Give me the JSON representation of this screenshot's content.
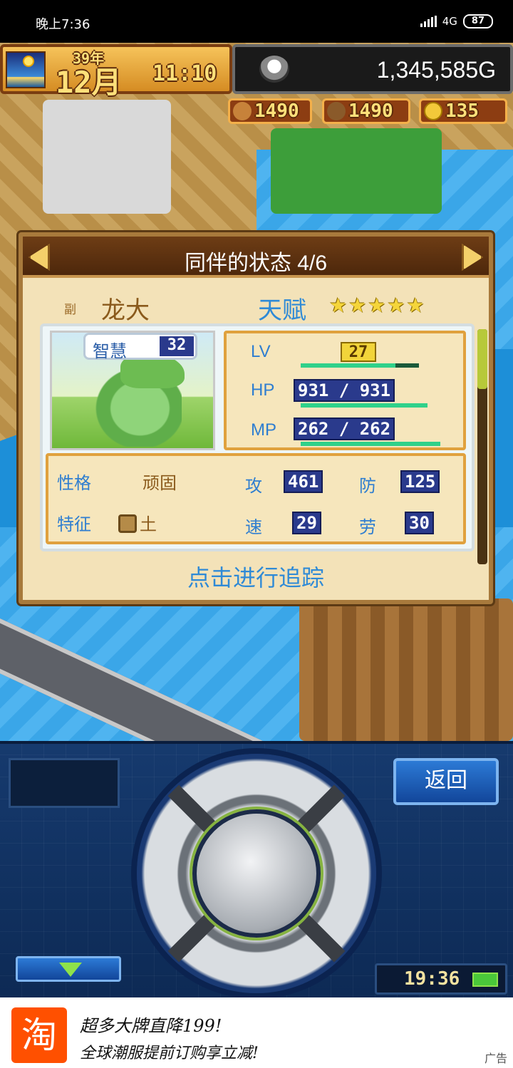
{
  "status_bar": {
    "time": "晚上7:36",
    "network": "4G",
    "battery": "87"
  },
  "hud": {
    "year": "39年",
    "month": "12月",
    "clock": "11:10",
    "money": "1,345,585G",
    "resources": [
      {
        "name": "wood-plank",
        "value": "1490"
      },
      {
        "name": "timber",
        "value": "1490"
      },
      {
        "name": "coin",
        "value": "135"
      }
    ]
  },
  "dialog": {
    "title": "同伴的状态 4/6",
    "sub_tag": "副",
    "name": "龙大",
    "talent_label": "天赋",
    "stars": "★★★★★",
    "star_count": 5,
    "wisdom_label": "智慧",
    "wisdom_value": "32",
    "lv_label": "LV",
    "lv_value": "27",
    "lv_progress": 0.8,
    "hp_label": "HP",
    "hp_value": "931 / 931",
    "mp_label": "MP",
    "mp_value": "262 / 262",
    "personality_label": "性格",
    "personality_value": "顽固",
    "trait_label": "特征",
    "trait_value": "土",
    "atk_label": "攻",
    "atk_value": "461",
    "def_label": "防",
    "def_value": "125",
    "spd_label": "速",
    "spd_value": "29",
    "lab_label": "劳",
    "lab_value": "30",
    "track_label": "点击进行追踪"
  },
  "controller": {
    "back_label": "返回",
    "clock": "19:36"
  },
  "ad": {
    "logo": "淘",
    "line1": "超多大牌直降199!",
    "line2": "全球潮服提前订购享立减!",
    "tag": "广告"
  }
}
